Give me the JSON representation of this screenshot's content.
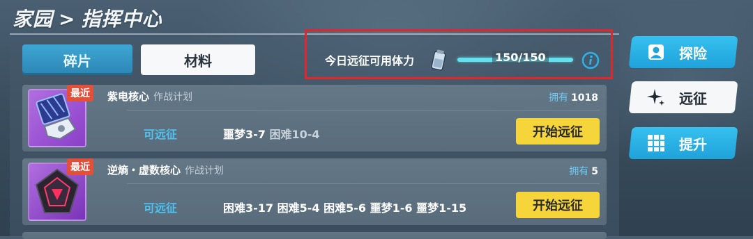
{
  "breadcrumb": {
    "home": "家园",
    "separator": ">",
    "current": "指挥中心"
  },
  "tabs": [
    {
      "label": "碎片",
      "active": false
    },
    {
      "label": "材料",
      "active": true
    }
  ],
  "stamina": {
    "label": "今日远征可用体力",
    "value_text": "150/150",
    "current": 150,
    "max": 150,
    "icon": "potion-icon",
    "info_icon": "info-icon"
  },
  "items": [
    {
      "name": "紫电核心",
      "plan": "作战计划",
      "badge": "最近",
      "owned_label": "拥有",
      "owned_count": "1018",
      "status": "可远征",
      "stages": [
        "噩梦3-7",
        "困难10-4"
      ],
      "button": "开始远征"
    },
    {
      "name": "逆熵・虚数核心",
      "plan": "作战计划",
      "badge": "最近",
      "owned_label": "拥有",
      "owned_count": "5",
      "status": "可远征",
      "stages": [
        "困难3-17",
        "困难5-4",
        "困难5-6",
        "噩梦1-6",
        "噩梦1-15"
      ],
      "button": "开始远征"
    }
  ],
  "side_nav": [
    {
      "label": "探险",
      "icon": "person-icon",
      "active": false
    },
    {
      "label": "远征",
      "icon": "sparkle-icon",
      "active": true
    },
    {
      "label": "提升",
      "icon": "grid-icon",
      "active": false
    }
  ],
  "colors": {
    "accent_blue": "#2fb3e8",
    "start_button": "#f5d53a",
    "highlight_box": "#e3262a",
    "badge": "#e2503a"
  }
}
